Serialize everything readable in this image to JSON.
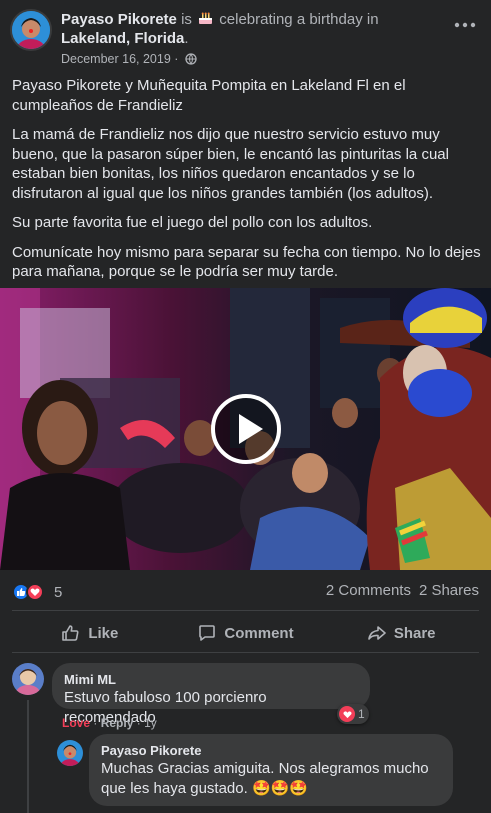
{
  "header": {
    "author": "Payaso Pikorete",
    "is_word": "is",
    "activity": "celebrating a birthday in",
    "location": "Lakeland, Florida",
    "location_suffix": ".",
    "date": "December 16, 2019",
    "date_separator": "·",
    "privacy_icon": "globe-icon",
    "more_icon": "more-dots-icon"
  },
  "post": {
    "paragraphs": [
      "Payaso Pikorete y Muñequita Pompita en Lakeland Fl en el cumpleaños de Frandieliz",
      "La mamá de Frandieliz nos dijo que nuestro servicio estuvo muy bueno, que la pasaron súper bien, le encantó las pinturitas la cual estaban bien bonitas, los niños quedaron encantados y se lo disfrutaron al igual que los niños grandes también (los adultos).",
      "Su parte favorita fue el juego del pollo con los adultos.",
      "Comunícate hoy mismo para separar su fecha con tiempo. No lo dejes para mañana, porque se le podría ser muy tarde."
    ]
  },
  "video": {
    "play_icon": "play-icon"
  },
  "stats": {
    "reaction_count": "5",
    "comments": "2 Comments",
    "shares": "2 Shares"
  },
  "actions": {
    "like": "Like",
    "comment": "Comment",
    "share": "Share"
  },
  "comments": [
    {
      "name": "Mimi ML",
      "text": "Estuvo fabuloso 100 porcienro recomendado",
      "reaction_label": "Love",
      "reply_label": "Reply",
      "time": "1y",
      "reaction_count": "1"
    },
    {
      "name": "Payaso Pikorete",
      "text": "Muchas Gracias amiguita. Nos alegramos mucho que les haya gustado. 🤩🤩🤩"
    }
  ],
  "colors": {
    "background": "#242526",
    "bubble": "#3a3b3c",
    "like_blue": "#1877f2",
    "love_red": "#f33e58",
    "muted_text": "#b0b3b8"
  }
}
